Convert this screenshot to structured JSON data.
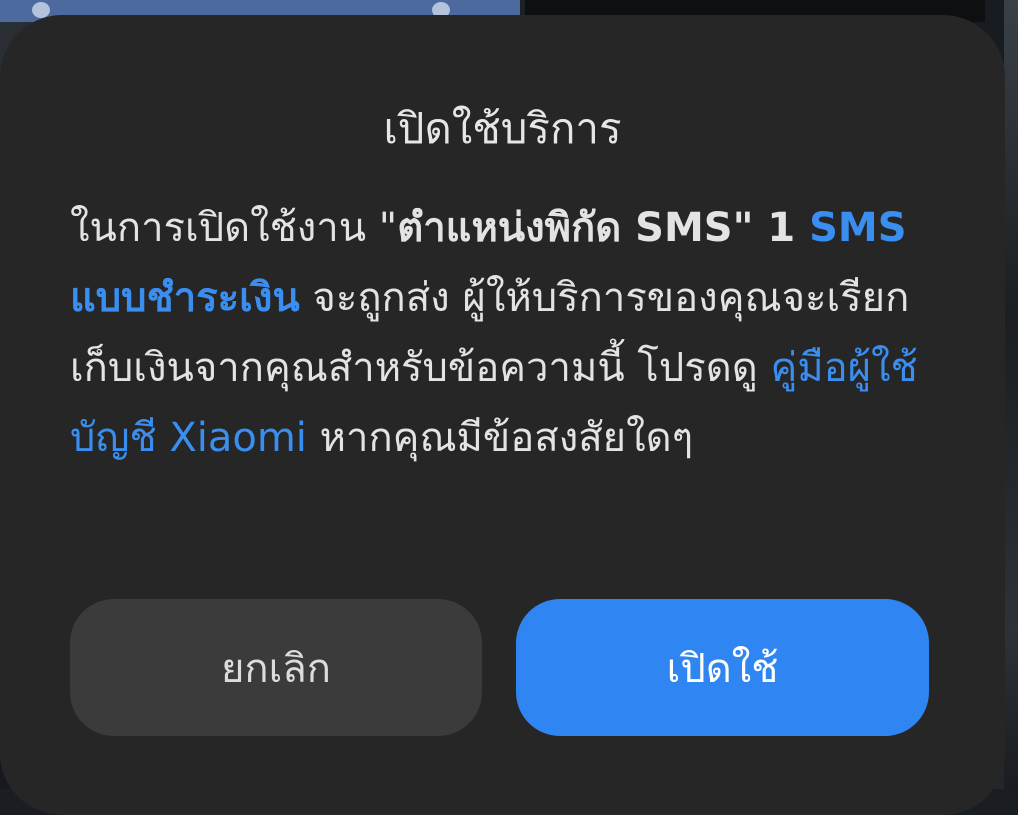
{
  "dialog": {
    "title": "เปิดใช้บริการ",
    "message": {
      "part1": "ในการเปิดใช้งาน \"",
      "feature_name": "ตำแหน่งพิกัด SMS",
      "part2": "\" 1 ",
      "paid_sms_link": "SMS แบบชำระเงิน",
      "part3": " จะถูกส่ง ผู้ให้บริการของคุณจะเรียกเก็บเงินจากคุณสำหรับข้อความนี้ โปรดดู ",
      "manual_link": "คู่มือผู้ใช้บัญชี Xiaomi",
      "part4": " หากคุณมีข้อสงสัยใดๆ"
    },
    "buttons": {
      "cancel_label": "ยกเลิก",
      "enable_label": "เปิดใช้"
    }
  },
  "colors": {
    "dialog_bg": "#262626",
    "accent": "#2f86f3",
    "link": "#3a8eef",
    "cancel_bg": "#3b3b3b"
  }
}
